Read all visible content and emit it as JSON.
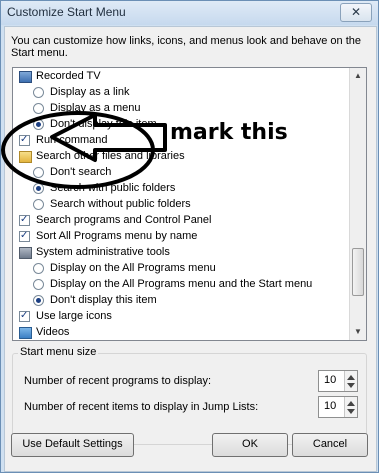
{
  "window": {
    "title": "Customize Start Menu",
    "close_glyph": "✕"
  },
  "description": "You can customize how links, icons, and menus look and behave on the Start menu.",
  "items": [
    {
      "kind": "header",
      "icon": "monitor-icon",
      "label": "Recorded TV"
    },
    {
      "kind": "radio",
      "checked": false,
      "label": "Display as a link"
    },
    {
      "kind": "radio",
      "checked": false,
      "label": "Display as a menu"
    },
    {
      "kind": "radio",
      "checked": true,
      "label": "Don't display this item"
    },
    {
      "kind": "check",
      "checked": true,
      "label": "Run command"
    },
    {
      "kind": "header",
      "icon": "folder-icon",
      "label": "Search other files and libraries"
    },
    {
      "kind": "radio",
      "checked": false,
      "label": "Don't search"
    },
    {
      "kind": "radio",
      "checked": true,
      "label": "Search with public folders"
    },
    {
      "kind": "radio",
      "checked": false,
      "label": "Search without public folders"
    },
    {
      "kind": "check",
      "checked": true,
      "label": "Search programs and Control Panel"
    },
    {
      "kind": "check",
      "checked": true,
      "label": "Sort All Programs menu by name"
    },
    {
      "kind": "header",
      "icon": "tools-icon",
      "label": "System administrative tools"
    },
    {
      "kind": "radio",
      "checked": false,
      "label": "Display on the All Programs menu"
    },
    {
      "kind": "radio",
      "checked": false,
      "label": "Display on the All Programs menu and the Start menu"
    },
    {
      "kind": "radio",
      "checked": true,
      "label": "Don't display this item"
    },
    {
      "kind": "check",
      "checked": true,
      "label": "Use large icons"
    },
    {
      "kind": "header",
      "icon": "videos-icon",
      "label": "Videos"
    }
  ],
  "size_group": {
    "legend": "Start menu size",
    "recent_programs_label": "Number of recent programs to display:",
    "recent_programs_value": "10",
    "jump_lists_label": "Number of recent items to display in Jump Lists:",
    "jump_lists_value": "10"
  },
  "buttons": {
    "defaults": "Use Default Settings",
    "ok": "OK",
    "cancel": "Cancel"
  },
  "annotation": {
    "text": "mark this"
  },
  "colors": {
    "accent": "#1c3f83",
    "title_bar": "#cfe0f1"
  }
}
